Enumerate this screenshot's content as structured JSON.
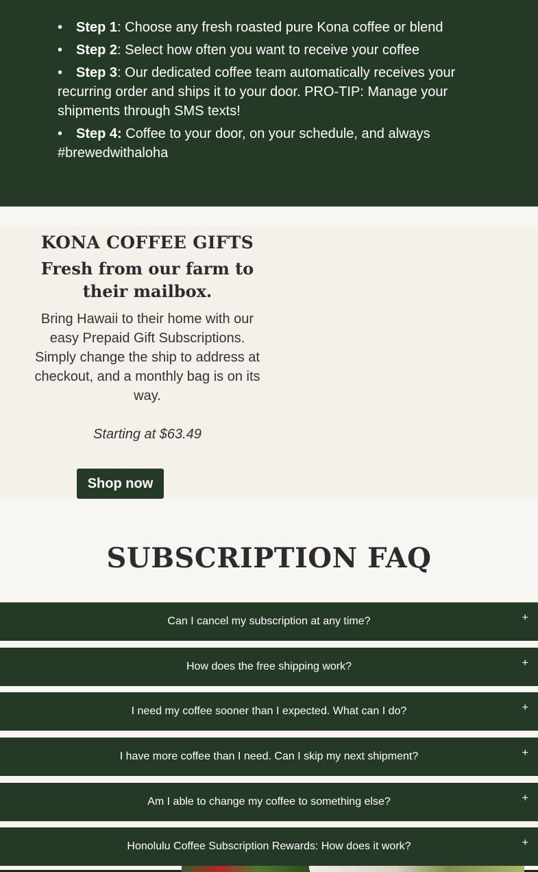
{
  "steps": [
    {
      "label": "Step 1",
      "sep": ":",
      "text": " Choose any fresh roasted pure Kona coffee or blend"
    },
    {
      "label": "Step 2",
      "sep": ":",
      "text": " Select how often you want to receive your coffee"
    },
    {
      "label": "Step 3",
      "sep": ":",
      "text": " Our dedicated coffee team automatically receives your recurring order and ships it to your door. PRO-TIP: Manage your shipments through SMS texts!"
    },
    {
      "label": "Step 4:",
      "sep": "",
      "text": " Coffee to your door, on your schedule, and always #brewedwithaloha"
    }
  ],
  "gifts": {
    "kicker": "KONA COFFEE GIFTS",
    "headline": "Fresh from our farm to their mailbox.",
    "body": "Bring Hawaii to their home with our easy Prepaid Gift Subscriptions. Simply change the ship to address at checkout, and a monthly bag is on its way.",
    "price": "Starting at $63.49",
    "button": "Shop now"
  },
  "faq": {
    "title": "SUBSCRIPTION FAQ",
    "items": [
      {
        "question": "Can I cancel my subscription at any time?",
        "icon": "+"
      },
      {
        "question": "How does the free shipping work?",
        "icon": "+"
      },
      {
        "question": "I need my coffee sooner than I expected. What can I do?",
        "icon": "+"
      },
      {
        "question": "I have more coffee than I need. Can I skip my next shipment?",
        "icon": "+"
      },
      {
        "question": "Am I able to change my coffee to something else?",
        "icon": "+"
      },
      {
        "question": "Honolulu Coffee Subscription Rewards: How does it work?",
        "icon": "+"
      }
    ]
  },
  "colors": {
    "dark_green": "#253a26",
    "cream": "#f4f0ea",
    "off_white": "#f7f6f2"
  }
}
